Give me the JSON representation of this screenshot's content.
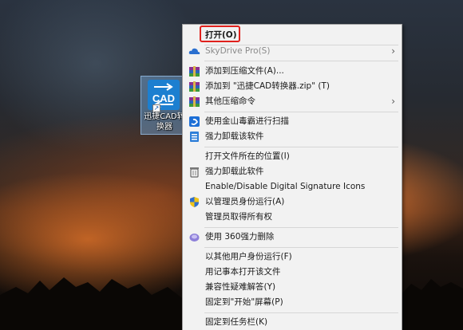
{
  "desktop": {
    "icon_label": "迅捷CAD转换器",
    "icon_glyph_text": "CAD"
  },
  "context_menu": {
    "items": [
      {
        "label": "打开(O)",
        "icon": "none",
        "bold": true
      },
      {
        "label": "SkyDrive Pro(S)",
        "icon": "cloud-icon",
        "disabled": true,
        "submenu": true
      },
      {
        "label": "添加到压缩文件(A)...",
        "icon": "winrar-icon"
      },
      {
        "label": "添加到 \"迅捷CAD转换器.zip\" (T)",
        "icon": "winrar-icon"
      },
      {
        "label": "其他压缩命令",
        "icon": "winrar-icon",
        "submenu": true
      },
      {
        "label": "使用金山毒霸进行扫描",
        "icon": "kingsoft-antivirus-icon"
      },
      {
        "label": "强力卸载该软件",
        "icon": "uninstall-icon"
      },
      {
        "label": "打开文件所在的位置(I)",
        "icon": "none"
      },
      {
        "label": "强力卸载此软件",
        "icon": "trash-icon"
      },
      {
        "label": "Enable/Disable Digital Signature Icons",
        "icon": "none"
      },
      {
        "label": "以管理员身份运行(A)",
        "icon": "uac-shield-icon"
      },
      {
        "label": "管理员取得所有权",
        "icon": "none"
      },
      {
        "label": "使用 360强力删除",
        "icon": "360-delete-icon"
      },
      {
        "label": "以其他用户身份运行(F)",
        "icon": "none"
      },
      {
        "label": "用记事本打开该文件",
        "icon": "none"
      },
      {
        "label": "兼容性疑难解答(Y)",
        "icon": "none"
      },
      {
        "label": "固定到\"开始\"屏幕(P)",
        "icon": "none"
      },
      {
        "label": "固定到任务栏(K)",
        "icon": "none"
      }
    ],
    "submenu_arrow": "›"
  },
  "colors": {
    "menu_background": "#f2f2f2",
    "highlight_red": "#e0211d",
    "icon_blue": "#1c7fd0"
  }
}
